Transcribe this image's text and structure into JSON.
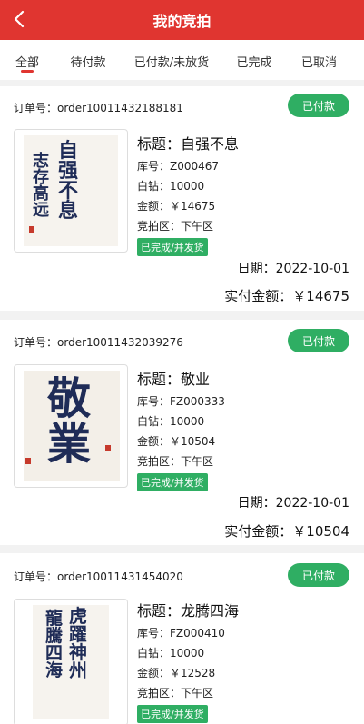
{
  "header": {
    "title": "我的竞拍",
    "back_icon": "chevron-left-icon"
  },
  "tabs": [
    {
      "label": "全部",
      "active": true
    },
    {
      "label": "待付款",
      "active": false
    },
    {
      "label": "已付款/未放货",
      "active": false
    },
    {
      "label": "已完成",
      "active": false
    },
    {
      "label": "已取消",
      "active": false
    }
  ],
  "orders": [
    {
      "order_label": "订单号：",
      "order_no": "order10011432188181",
      "badge": "已付款",
      "title": "标题：自强不息",
      "stock": "库号：Z000467",
      "white_drill": "白钻：10000",
      "amount": "金额：￥14675",
      "auction_area": "竞拍区：下午区",
      "status": "已完成/并发货",
      "date": "日期：2022-10-01",
      "paid": "实付金额：￥14675",
      "artwork": {
        "main_right": "自强不息",
        "main_left": "志存高远"
      }
    },
    {
      "order_label": "订单号：",
      "order_no": "order10011432039276",
      "badge": "已付款",
      "title": "标题：敬业",
      "stock": "库号：FZ000333",
      "white_drill": "白钻：10000",
      "amount": "金额：￥10504",
      "auction_area": "竞拍区：下午区",
      "status": "已完成/并发货",
      "date": "日期：2022-10-01",
      "paid": "实付金额：￥10504",
      "artwork": {
        "main": "敬業"
      }
    },
    {
      "order_label": "订单号：",
      "order_no": "order10011431454020",
      "badge": "已付款",
      "title": "标题：龙腾四海",
      "stock": "库号：FZ000410",
      "white_drill": "白钻：10000",
      "amount": "金额：￥12528",
      "auction_area": "竞拍区：下午区",
      "status": "已完成/并发货",
      "artwork": {
        "main_right": "虎躍神州",
        "main_left": "龍騰四海"
      }
    }
  ],
  "colors": {
    "brand_red": "#e03530",
    "green": "#2fae63",
    "ink": "#1f2c57"
  }
}
